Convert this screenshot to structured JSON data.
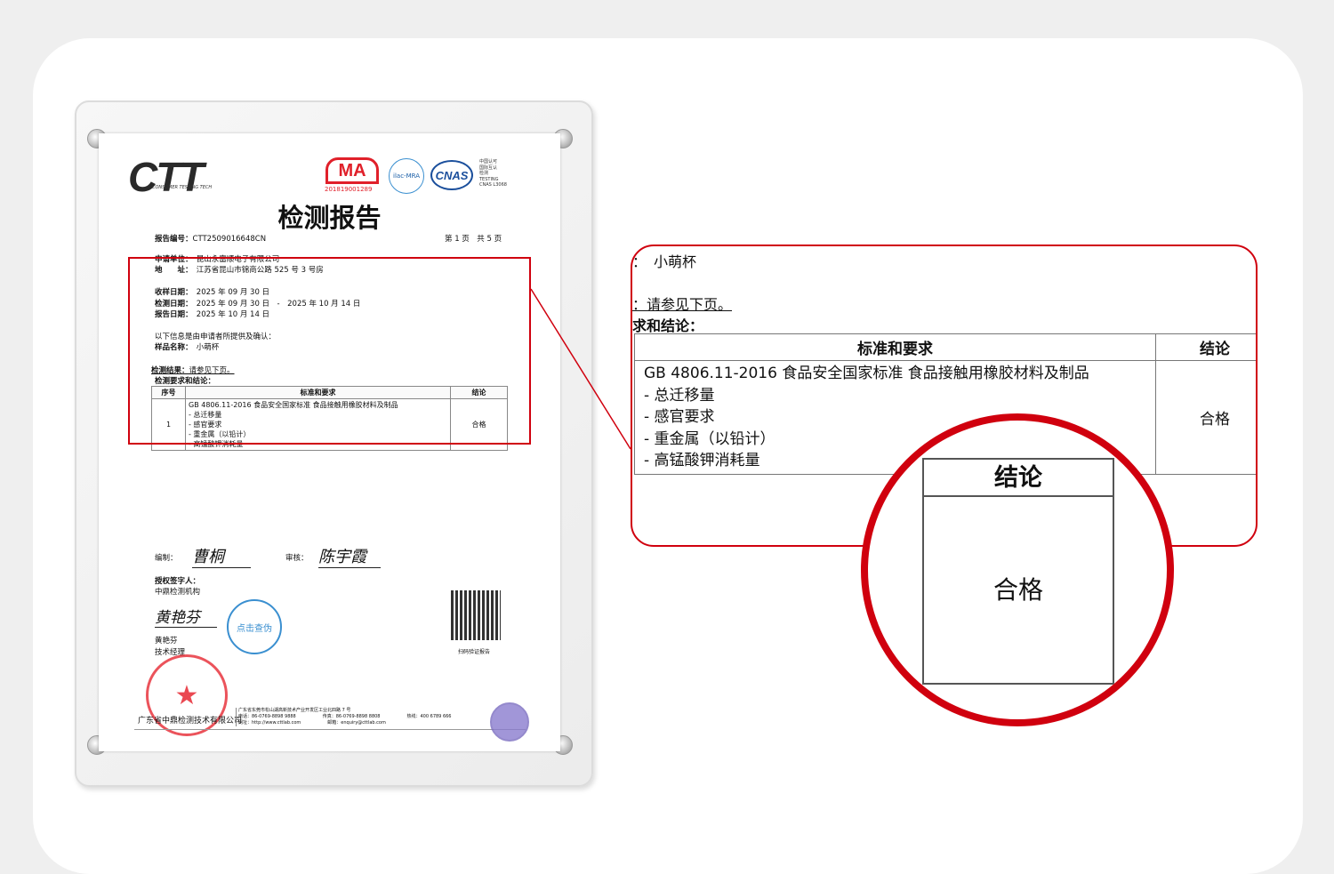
{
  "report": {
    "logo": "CTT",
    "logo_sub": "CONSUMER TESTING TECH",
    "cma_number": "201819001289",
    "ilac": "ilac-MRA",
    "cnas": "CNAS",
    "cnas_text": [
      "中国认可",
      "国际互认",
      "检测",
      "TESTING",
      "CNAS L3068"
    ],
    "title": "检测报告",
    "report_no_label": "报告编号：",
    "report_no": "CTT2509016648CN",
    "page_info": "第 1 页　共 5 页",
    "applicant_label": "申请单位：",
    "applicant": "昆山永富顺电子有限公司",
    "address_label": "地　　址：",
    "address": "江苏省昆山市锦商公路 525 号 3 号房",
    "received_label": "收样日期：",
    "received": "2025 年 09 月 30 日",
    "tested_label": "检测日期：",
    "tested": "2025 年 09 月 30 日　-　2025 年 10 月 14 日",
    "reported_label": "报告日期：",
    "reported": "2025 年 10 月 14 日",
    "info_note": "以下信息是由申请者所提供及确认：",
    "sample_label": "样品名称：",
    "sample": "小萌杯",
    "result_label": "检测结果：",
    "result": "请参见下页。",
    "req_label": "检测要求和结论：",
    "table": {
      "headers": [
        "序号",
        "标准和要求",
        "结论"
      ],
      "row": {
        "no": "1",
        "standard": "GB 4806.11-2016  食品安全国家标准  食品接触用橡胶材料及制品",
        "items": [
          "- 总迁移量",
          "- 感官要求",
          "- 重金属（以铅计）",
          "- 高锰酸钾消耗量"
        ],
        "conclusion": "合格"
      }
    },
    "compiler_label": "编制：",
    "compiler_sig": "曹桐",
    "reviewer_label": "审核：",
    "reviewer_sig": "陈宇霞",
    "signer_label": "授权签字人：",
    "signer_org": "中鼎检测机构",
    "signer_sig": "黄艳芬",
    "signer_name": "黄艳芬",
    "signer_title": "技术经理",
    "verify_stamp": "点击查伪",
    "qr_caption": "扫码验证报告",
    "company": "广东省中鼎检测技术有限公司",
    "footer_address": "广东省东莞市松山湖高新技术产业开发区工业北四路 7 号",
    "phone": "电话：86-0769-8898 9888",
    "fax": "传真：86-0769-8898 8808",
    "hotline": "热线：400 6789 666",
    "web": "网址：http://www.cttlab.com",
    "email": "邮箱：enquiry@cttlab.com"
  },
  "zoom": {
    "sample_suffix": "：　小萌杯",
    "result_suffix": "：请参见下页。",
    "req_suffix": "求和结论：",
    "header_standard": "标准和要求",
    "header_conclusion": "结论",
    "standard": "GB 4806.11-2016  食品安全国家标准  食品接触用橡胶材料及制品",
    "items": [
      "-  总迁移量",
      "-  感官要求",
      "-  重金属（以铅计）",
      "-  高锰酸钾消耗量"
    ],
    "conclusion": "合格"
  },
  "magnifier": {
    "header": "结论",
    "value": "合格"
  },
  "colors": {
    "accent": "#d0000e"
  }
}
